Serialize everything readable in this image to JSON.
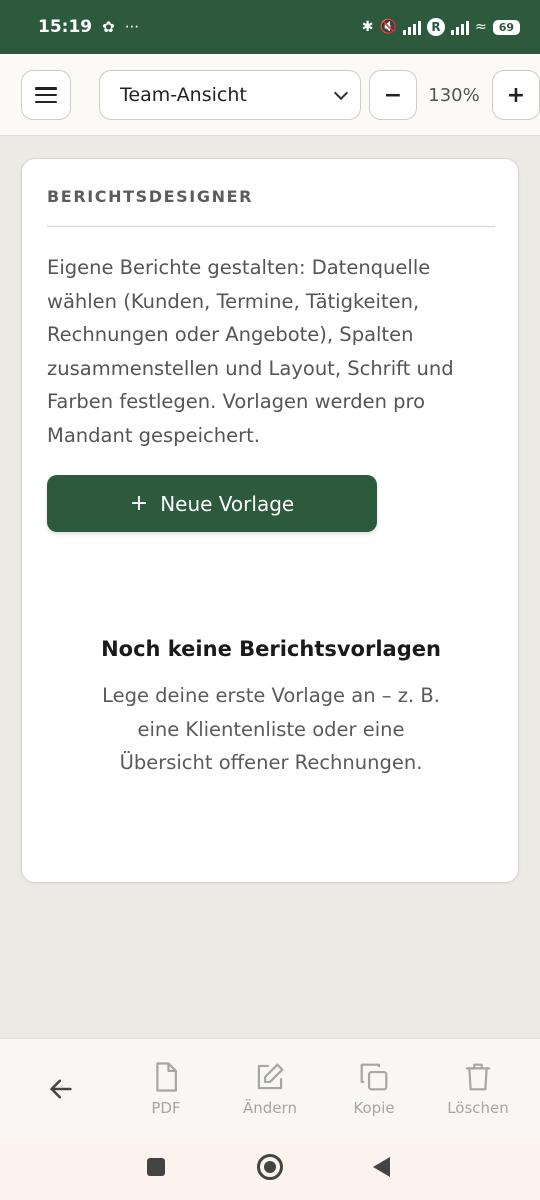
{
  "status_bar": {
    "time": "15:19",
    "battery": "69",
    "network_badge": "R",
    "more_indicator": "···"
  },
  "toolbar": {
    "view_select_value": "Team-Ansicht",
    "zoom_minus_label": "−",
    "zoom_level": "130%",
    "zoom_plus_label": "+"
  },
  "card": {
    "title": "BERICHTSDESIGNER",
    "description": "Eigene Berichte gestalten: Datenquelle wählen (Kunden, Termine, Tätigkeiten, Rechnungen oder Angebote), Spalten zusammenstellen und Layout, Schrift und Farben festlegen. Vorlagen werden pro Mandant gespeichert.",
    "new_button_icon": "+",
    "new_button_label": "Neue Vorlage",
    "empty_title": "Noch keine Berichtsvorlagen",
    "empty_text": "Lege deine erste Vorlage an – z. B. eine Klientenliste oder eine Übersicht offener Rechnungen."
  },
  "actions": {
    "pdf": "PDF",
    "edit": "Ändern",
    "copy": "Kopie",
    "delete": "Löschen"
  },
  "colors": {
    "brand_green": "#2d5a3d",
    "disabled_gray": "#a6a6a6"
  }
}
